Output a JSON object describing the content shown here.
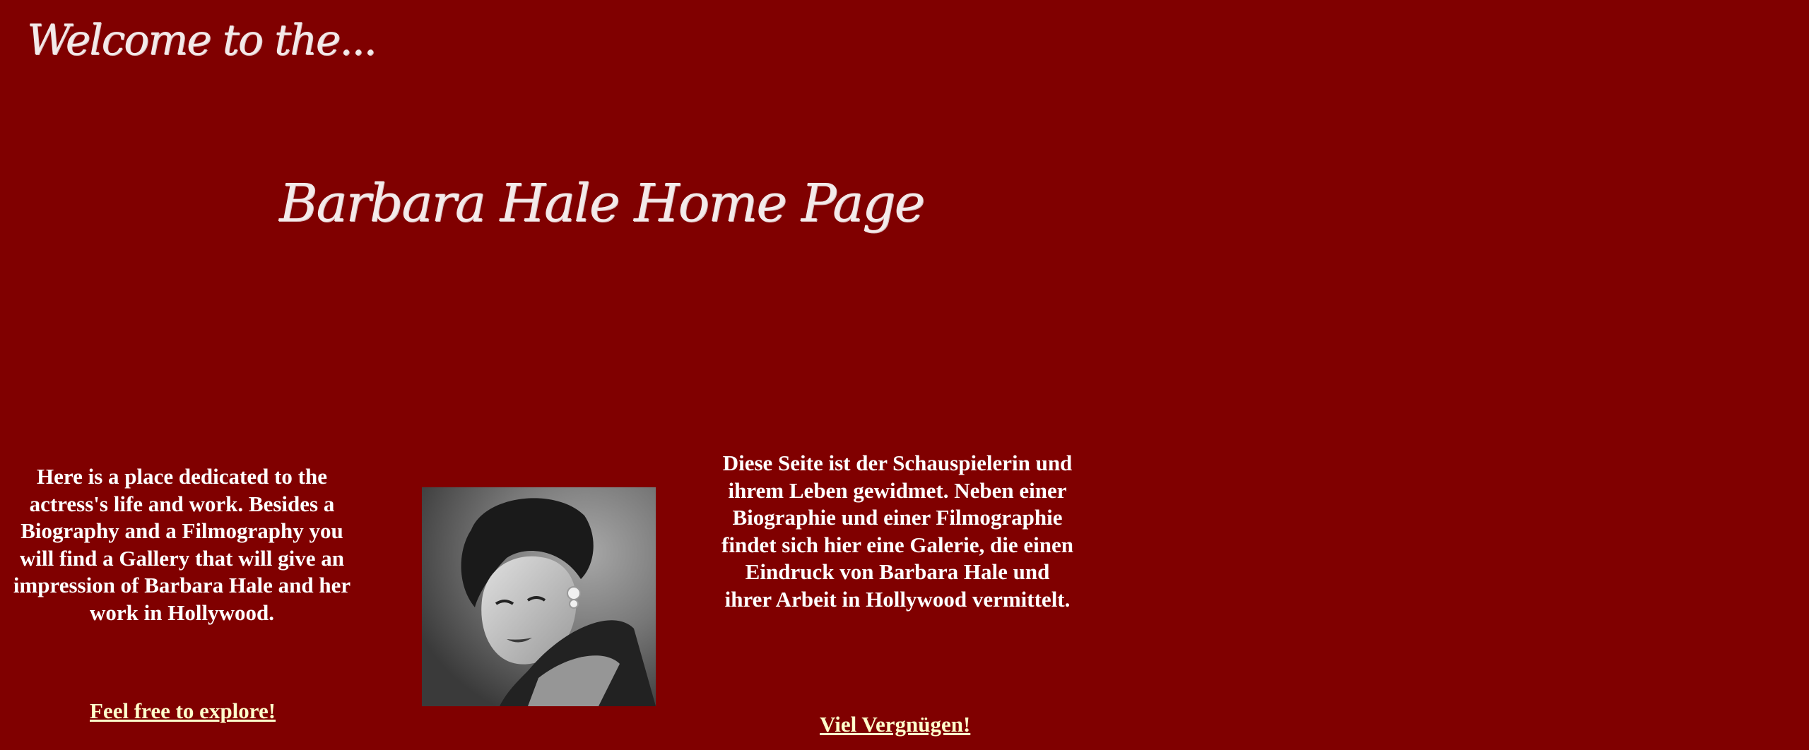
{
  "header": {
    "welcome": "Welcome to the...",
    "title": "Barbara Hale Home Page"
  },
  "intro": {
    "english": "Here is a place dedicated to the actress's life and work. Besides a Biography and a Filmography you will find a Gallery that will give an impression of Barbara Hale and her work in Hollywood.",
    "german": "Diese Seite ist der Schauspielerin und ihrem Leben gewidmet. Neben einer Biographie und einer Filmographie findet sich hier eine Galerie, die einen Eindruck von Barbara Hale und ihrer Arbeit in Hollywood vermittelt."
  },
  "links": {
    "explore_en": "Feel free to explore!",
    "explore_de": "Viel Vergnügen!"
  },
  "photo": {
    "subject": "portrait-photo"
  },
  "colors": {
    "background": "#800000",
    "text": "#ffffff",
    "link": "#ffffcc"
  }
}
